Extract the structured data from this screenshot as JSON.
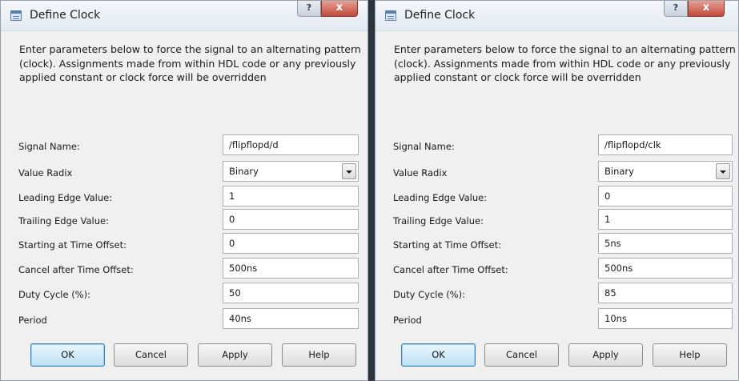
{
  "dialogs": [
    {
      "title": "Define Clock",
      "description": "Enter parameters below to force the signal to an alternating pattern (clock). Assignments made from within HDL code or any previously applied constant or clock force will be overridden",
      "fields": [
        {
          "label": "Signal Name:",
          "value": "/flipflopd/d"
        },
        {
          "label": "Value Radix",
          "value": "Binary"
        },
        {
          "label": "Leading Edge Value:",
          "value": "1"
        },
        {
          "label": "Trailing Edge Value:",
          "value": "0"
        },
        {
          "label": "Starting at Time Offset:",
          "value": "0"
        },
        {
          "label": "Cancel after Time Offset:",
          "value": "500ns"
        },
        {
          "label": "Duty Cycle (%):",
          "value": "50"
        },
        {
          "label": "Period",
          "value": "40ns"
        }
      ],
      "buttons": {
        "ok": "OK",
        "cancel": "Cancel",
        "apply": "Apply",
        "help": "Help"
      },
      "titlebar": {
        "help": "?",
        "close": "x"
      }
    },
    {
      "title": "Define Clock",
      "description": "Enter parameters below to force the signal to an alternating pattern (clock). Assignments made from within HDL code or any previously applied constant or clock force will be overridden",
      "fields": [
        {
          "label": "Signal Name:",
          "value": "/flipflopd/clk"
        },
        {
          "label": "Value Radix",
          "value": "Binary"
        },
        {
          "label": "Leading Edge Value:",
          "value": "0"
        },
        {
          "label": "Trailing Edge Value:",
          "value": "1"
        },
        {
          "label": "Starting at Time Offset:",
          "value": "5ns"
        },
        {
          "label": "Cancel after Time Offset:",
          "value": "500ns"
        },
        {
          "label": "Duty Cycle (%):",
          "value": "85"
        },
        {
          "label": "Period",
          "value": "10ns"
        }
      ],
      "buttons": {
        "ok": "OK",
        "cancel": "Cancel",
        "apply": "Apply",
        "help": "Help"
      },
      "titlebar": {
        "help": "?",
        "close": "x"
      }
    }
  ]
}
